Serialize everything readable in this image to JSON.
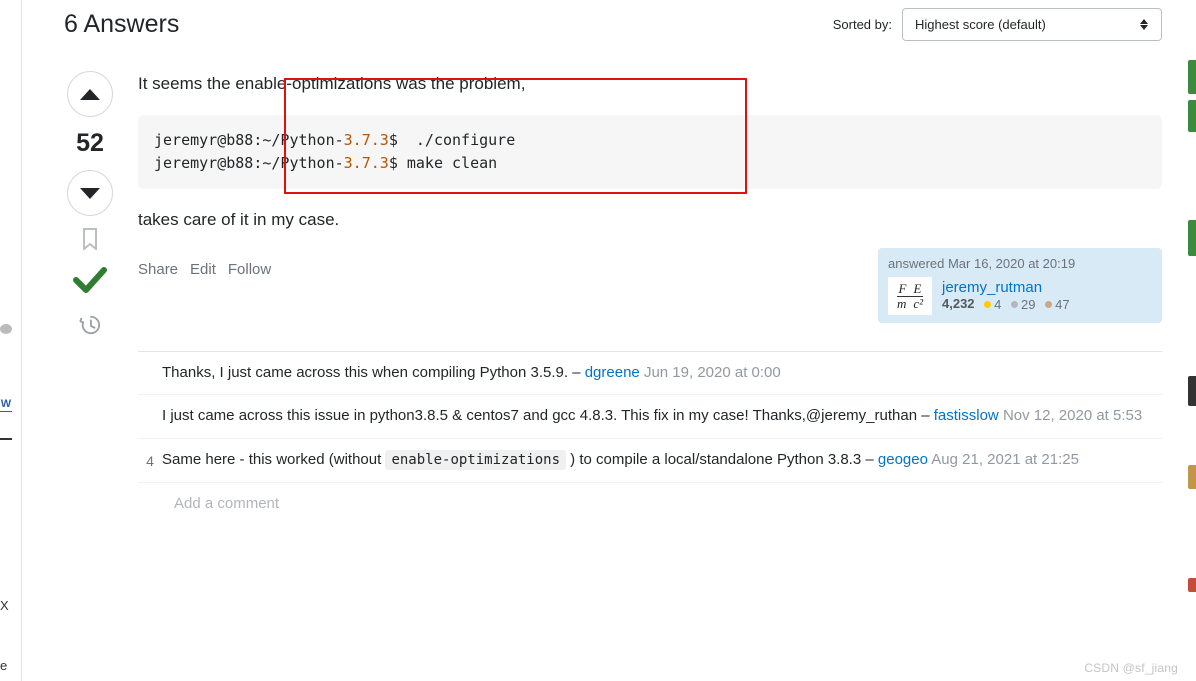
{
  "header": {
    "title": "6 Answers",
    "sorted_by_label": "Sorted by:",
    "sort_selected": "Highest score (default)"
  },
  "vote": {
    "score": "52"
  },
  "post": {
    "p1": "It seems the enable-optimizations was the problem,",
    "code_prompt1_a": "jeremyr@b88:~/Python-",
    "code_ver1": "3.7.3",
    "code_prompt1_b": "$  ./configure",
    "code_prompt2_a": "jeremyr@b88:~/Python-",
    "code_ver2": "3.7.3",
    "code_prompt2_b": "$ make clean",
    "p2": "takes care of it in my case."
  },
  "share": {
    "share": "Share",
    "edit": "Edit",
    "follow": "Follow"
  },
  "usercard": {
    "when": "answered Mar 16, 2020 at 20:19",
    "name": "jeremy_rutman",
    "rep": "4,232",
    "gold": "4",
    "silver": "29",
    "bronze": "47"
  },
  "comments": [
    {
      "score": "",
      "text": "Thanks, I just came across this when compiling Python 3.5.9.",
      "dash": " – ",
      "user": "dgreene",
      "date": "Jun 19, 2020 at 0:00"
    },
    {
      "score": "",
      "text": "I just came across this issue in python3.8.5 & centos7 and gcc 4.8.3. This fix in my case! Thanks,@jeremy_ruthan",
      "dash": " – ",
      "user": "fastisslow",
      "date": "Nov 12, 2020 at 5:53"
    },
    {
      "score": "4",
      "text_a": "Same here - this worked (without ",
      "code": "enable-optimizations",
      "text_b": " ) to compile a local/standalone Python 3.8.3",
      "dash": " – ",
      "user": "geogeo",
      "date": "Aug 21, 2021 at 21:25"
    }
  ],
  "addcomment": "Add a comment",
  "watermark": "CSDN @sf_jiang"
}
